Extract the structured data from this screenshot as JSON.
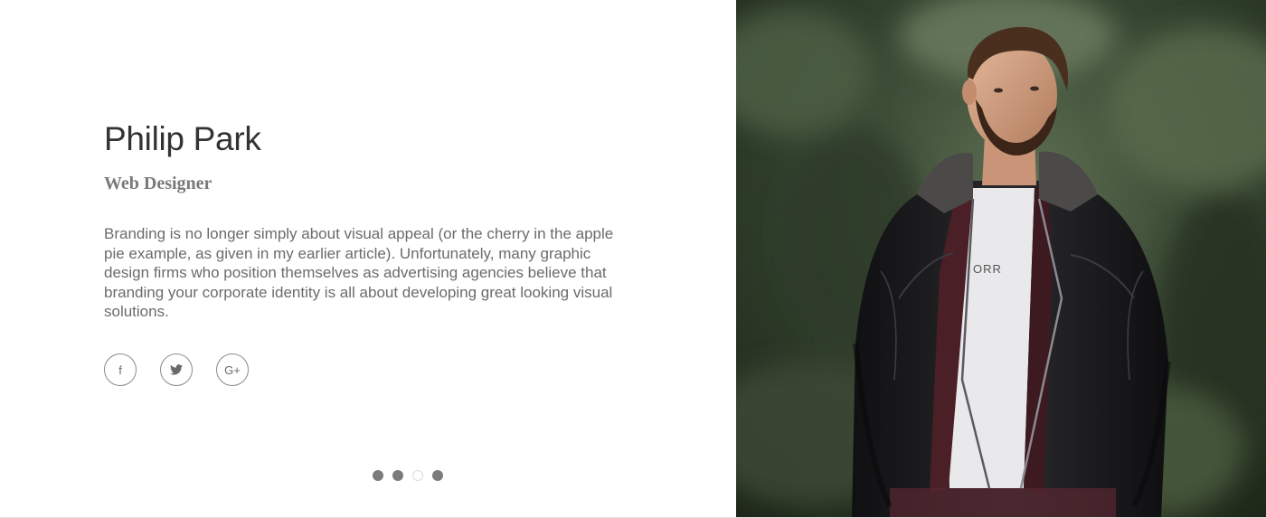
{
  "profile": {
    "name": "Philip Park",
    "role": "Web Designer",
    "bio": "Branding is no longer simply about visual appeal (or the cherry in the apple pie example, as given in my earlier article). Unfortunately, many graphic design firms who position themselves as advertising agencies believe that branding your corporate identity is all about developing great looking visual solutions."
  },
  "social": [
    {
      "icon": "facebook-icon",
      "glyph": "f"
    },
    {
      "icon": "twitter-icon"
    },
    {
      "icon": "google-plus-icon",
      "glyph": "G+"
    }
  ],
  "pagination": {
    "count": 4,
    "active_index": 3
  },
  "shirt_text": "ORR",
  "colors": {
    "name": "#333333",
    "role": "#7a7a7a",
    "bio": "#6b6b6b",
    "icon_border": "#8a8a8a",
    "dot": "#7b7b7b",
    "forest": "#2d3a2b",
    "jacket": "#1c1c1e"
  }
}
